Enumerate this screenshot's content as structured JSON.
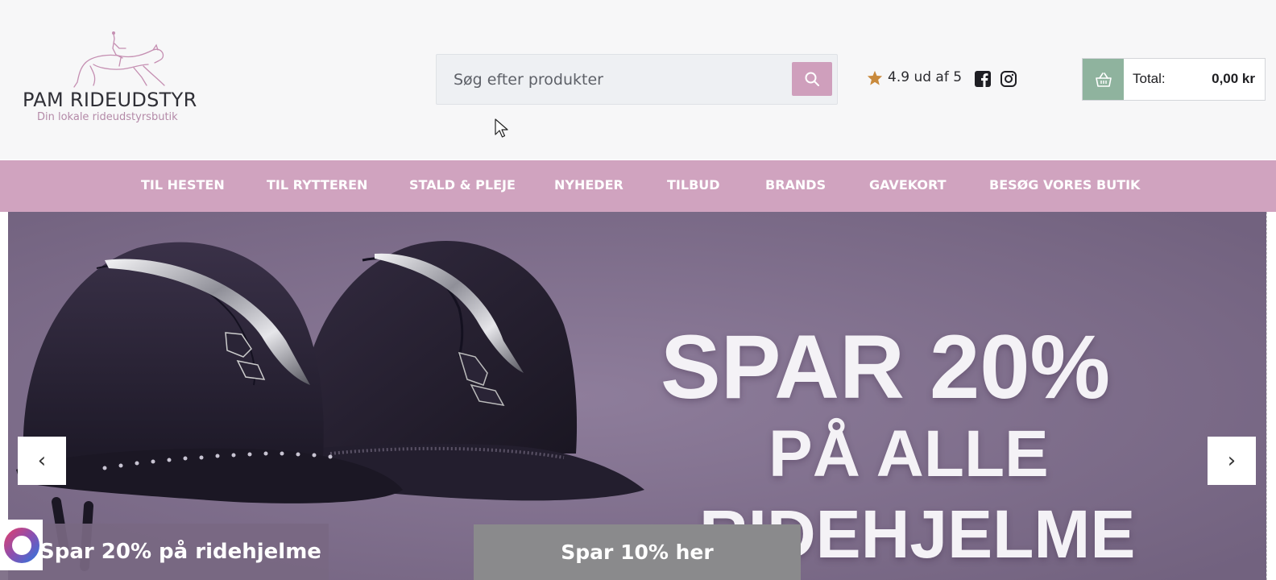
{
  "brand": {
    "name": "PAM RIDEUDSTYR",
    "tagline": "Din lokale rideudstyrsbutik",
    "accent": "#d0a3bf"
  },
  "search": {
    "placeholder": "Søg efter produkter",
    "value": "",
    "button_icon": "search-icon"
  },
  "rating": {
    "icon": "star-icon",
    "text": "4.9 ud af 5"
  },
  "social": [
    {
      "name": "facebook-icon"
    },
    {
      "name": "instagram-icon"
    }
  ],
  "cart": {
    "icon": "basket-icon",
    "label": "Total:",
    "total": "0,00 kr",
    "icon_bg": "#8fb39e"
  },
  "nav": {
    "items": [
      {
        "label": "TIL HESTEN"
      },
      {
        "label": "TIL RYTTEREN"
      },
      {
        "label": "STALD & PLEJE"
      },
      {
        "label": "NYHEDER"
      },
      {
        "label": "TILBUD"
      },
      {
        "label": "BRANDS"
      },
      {
        "label": "GAVEKORT"
      },
      {
        "label": "BESØG VORES BUTIK"
      }
    ]
  },
  "hero": {
    "line1": "SPAR 20%",
    "line2": "PÅ ALLE",
    "line3": "RIDEHJELME",
    "prev": "‹",
    "next": "›",
    "background": "#7e6d8b"
  },
  "promos": {
    "left": "Spar 20% på ridehjelme",
    "center": "Spar 10% her"
  }
}
